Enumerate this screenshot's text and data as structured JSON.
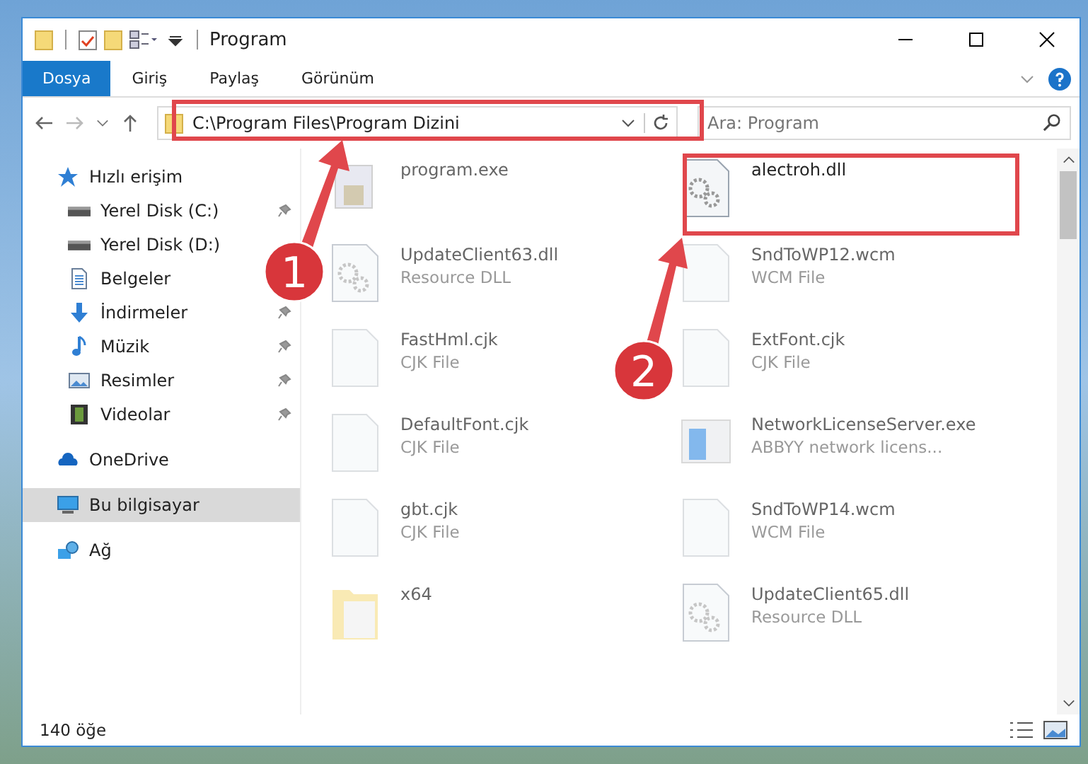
{
  "window": {
    "title": "Program"
  },
  "ribbon_tabs": [
    {
      "label": "Dosya",
      "selected": true
    },
    {
      "label": "Giriş",
      "selected": false
    },
    {
      "label": "Paylaş",
      "selected": false
    },
    {
      "label": "Görünüm",
      "selected": false
    }
  ],
  "address_bar": {
    "path": "C:\\Program Files\\Program Dizini"
  },
  "search": {
    "placeholder": "Ara: Program"
  },
  "sidebar": {
    "items": [
      {
        "label": "Hızlı erişim",
        "kind": "star",
        "selected": false,
        "pinned": false,
        "children": [
          {
            "label": "Yerel Disk (C:)",
            "kind": "drive",
            "selected": false,
            "pinned": true
          },
          {
            "label": "Yerel Disk (D:)",
            "kind": "drive",
            "selected": false,
            "pinned": false
          },
          {
            "label": "Belgeler",
            "kind": "doc",
            "selected": false,
            "pinned": false
          },
          {
            "label": "İndirmeler",
            "kind": "download",
            "selected": false,
            "pinned": true
          },
          {
            "label": "Müzik",
            "kind": "music",
            "selected": false,
            "pinned": true
          },
          {
            "label": "Resimler",
            "kind": "picture",
            "selected": false,
            "pinned": true
          },
          {
            "label": "Videolar",
            "kind": "film",
            "selected": false,
            "pinned": true
          }
        ]
      },
      {
        "label": "OneDrive",
        "kind": "cloud",
        "selected": false,
        "pinned": false
      },
      {
        "label": "Bu bilgisayar",
        "kind": "monitor",
        "selected": true,
        "pinned": false
      },
      {
        "label": "Ağ",
        "kind": "network",
        "selected": false,
        "pinned": false
      }
    ]
  },
  "files": [
    {
      "name": "program.exe",
      "kind": "exe",
      "blurred": true
    },
    {
      "name": "alectroh.dll",
      "kind": "dll",
      "blurred": false
    },
    {
      "name": "UpdateClient63.dll",
      "type": "Resource DLL",
      "kind": "dll",
      "blurred": true
    },
    {
      "name": "SndToWP12.wcm",
      "type": "WCM File",
      "kind": "file",
      "blurred": true
    },
    {
      "name": "FastHml.cjk",
      "type": "CJK File",
      "kind": "file",
      "blurred": true
    },
    {
      "name": "ExtFont.cjk",
      "type": "CJK File",
      "kind": "file",
      "blurred": true
    },
    {
      "name": "DefaultFont.cjk",
      "type": "CJK File",
      "kind": "file",
      "blurred": true
    },
    {
      "name": "NetworkLicenseServer.exe",
      "type": "ABBYY network licens...",
      "kind": "app",
      "blurred": true
    },
    {
      "name": "gbt.cjk",
      "type": "CJK File",
      "kind": "file",
      "blurred": true
    },
    {
      "name": "SndToWP14.wcm",
      "type": "WCM File",
      "kind": "file",
      "blurred": true
    },
    {
      "name": "x64",
      "kind": "folder",
      "blurred": true
    },
    {
      "name": "UpdateClient65.dll",
      "type": "Resource DLL",
      "kind": "dll",
      "blurred": true
    }
  ],
  "status_bar": {
    "count": "140 öğe"
  },
  "annotations": [
    {
      "number": "1"
    },
    {
      "number": "2"
    }
  ]
}
